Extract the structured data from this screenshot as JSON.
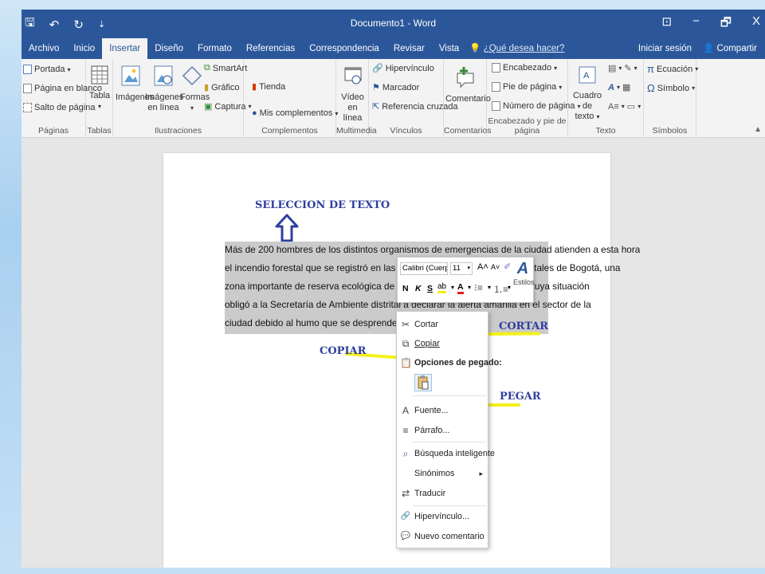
{
  "window": {
    "title": "Documento1 - Word",
    "controls": [
      "⊡",
      "−",
      "🗗",
      "X"
    ]
  },
  "qat": {
    "save": "🖫",
    "undo": "↶",
    "redo": "↻",
    "customize": "⇣"
  },
  "tabs": [
    "Archivo",
    "Inicio",
    "Insertar",
    "Diseño",
    "Formato",
    "Referencias",
    "Correspondencia",
    "Revisar",
    "Vista"
  ],
  "active_tab": "Insertar",
  "tell_me": "¿Qué desea hacer?",
  "signin": "Iniciar sesión",
  "share": "Compartir",
  "ribbon": {
    "paginas": {
      "label": "Páginas",
      "portada": "Portada",
      "pagina_blanco": "Página en blanco",
      "salto": "Salto de página"
    },
    "tablas": {
      "label": "Tablas",
      "tabla": "Tabla"
    },
    "ilustraciones": {
      "label": "Ilustraciones",
      "imagenes": "Imágenes",
      "imagenes_linea_1": "Imágenes",
      "imagenes_linea_2": "en línea",
      "formas": "Formas",
      "smartart": "SmartArt",
      "grafico": "Gráfico",
      "captura": "Captura"
    },
    "complementos": {
      "label": "Complementos",
      "tienda": "Tienda",
      "mis": "Mis complementos"
    },
    "multimedia": {
      "label": "Multimedia",
      "video_1": "Vídeo",
      "video_2": "en línea"
    },
    "vinculos": {
      "label": "Vínculos",
      "hipervinculo": "Hipervínculo",
      "marcador": "Marcador",
      "referencia": "Referencia cruzada"
    },
    "comentarios": {
      "label": "Comentarios",
      "comentario": "Comentario"
    },
    "encabezado_pie": {
      "label": "Encabezado y pie de página",
      "encabezado": "Encabezado",
      "pie": "Pie de página",
      "numero": "Número de página"
    },
    "texto": {
      "label": "Texto",
      "cuadro_1": "Cuadro de",
      "cuadro_2": "texto"
    },
    "simbolos": {
      "label": "Símbolos",
      "ecuacion": "Ecuación",
      "simbolo": "Símbolo"
    }
  },
  "annotations": {
    "seleccion": "SELECCION  DE  TEXTO",
    "cortar": "CORTAR",
    "copiar": "COPIAR",
    "pegar": "PEGAR"
  },
  "document": {
    "lines": [
      "Más de 200 hombres de los distintos organismos de emergencias de la ciudad atienden a esta hora",
      "el incendio forestal que se registró en las últimas horas en los cerros orientales de Bogotá, una",
      "zona importante de reserva ecológica de la ciudad ubicada en el oriente, cuya situación",
      "obligó a la Secretaría de Ambiente distrital a declarar la alerta amarilla en el sector de la",
      "ciudad debido al humo que se desprende de la conflagración."
    ]
  },
  "mini_toolbar": {
    "font": "Calibri (Cuerp",
    "size": "11",
    "bold": "N",
    "italic": "K",
    "underline": "S",
    "styles": "Estilos"
  },
  "context_menu": {
    "items": [
      {
        "label": "Cortar",
        "icon": "✂"
      },
      {
        "label": "Copiar",
        "icon": "⧉"
      },
      {
        "label": "Opciones de pegado:",
        "icon": "📋"
      },
      {
        "label": "Fuente...",
        "icon": "A"
      },
      {
        "label": "Párrafo...",
        "icon": "≡"
      },
      {
        "label": "Búsqueda inteligente",
        "icon": "⌕"
      },
      {
        "label": "Sinónimos",
        "icon": ""
      },
      {
        "label": "Traducir",
        "icon": "⇄"
      },
      {
        "label": "Hipervínculo...",
        "icon": "🔗"
      },
      {
        "label": "Nuevo comentario",
        "icon": "💬"
      }
    ],
    "submenu_arrow": "▸"
  },
  "colors": {
    "word_blue": "#2b579a",
    "annotation": "#2f3e9e",
    "highlighter": "#f3f01a",
    "selection": "#cbcbcb"
  }
}
